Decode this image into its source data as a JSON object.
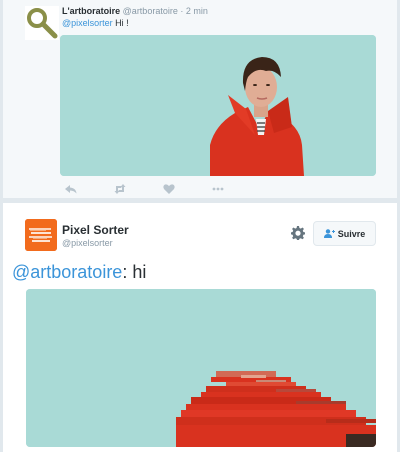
{
  "reply_tweet": {
    "author_name": "L'artboratoire",
    "author_handle": "@artboratoire",
    "separator": "·",
    "time": "2 min",
    "mention": "@pixelsorter",
    "text": " Hi !",
    "avatar_icon": "magnifier-icon",
    "actions": [
      "reply-icon",
      "retweet-icon",
      "favorite-icon",
      "more-icon"
    ]
  },
  "main_tweet": {
    "author_name": "Pixel Sorter",
    "author_handle": "@pixelsorter",
    "follow_label": "Suivre",
    "mention": "@artboratoire",
    "text": ": hi"
  },
  "colors": {
    "link": "#3b94d9",
    "avatar_orange": "#f26b1d",
    "media_background": "#a9dad6",
    "coat_red": "#d9321f"
  }
}
